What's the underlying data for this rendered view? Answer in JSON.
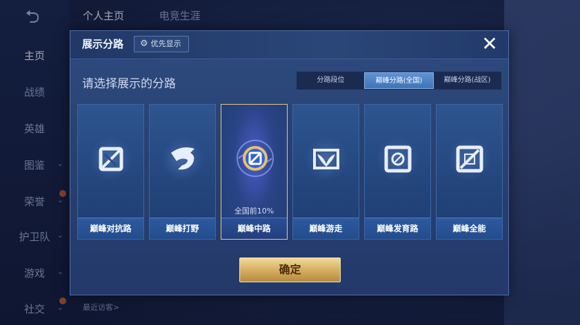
{
  "background": {
    "sidebar": [
      "主页",
      "战绩",
      "英雄",
      "图鉴",
      "荣誉",
      "护卫队",
      "游戏",
      "社交"
    ],
    "tabs": [
      "个人主页",
      "电竞生涯"
    ],
    "footer_text": "最近访客>"
  },
  "dialog": {
    "title": "展示分路",
    "priority_label": "优先显示",
    "prompt": "请选择展示的分路",
    "tabs": [
      {
        "label": "分路段位",
        "active": false
      },
      {
        "label": "巅峰分路(全国)",
        "active": true
      },
      {
        "label": "巅峰分路(战区)",
        "active": false
      }
    ],
    "cards": [
      {
        "label": "巅峰对抗路",
        "icon": "sword-cross-icon",
        "selected": false
      },
      {
        "label": "巅峰打野",
        "icon": "dragon-icon",
        "selected": false
      },
      {
        "label": "巅峰中路",
        "icon": "mage-emblem-icon",
        "selected": true,
        "rank": "全国前10%"
      },
      {
        "label": "巅峰游走",
        "icon": "wings-icon",
        "selected": false
      },
      {
        "label": "巅峰发育路",
        "icon": "target-icon",
        "selected": false
      },
      {
        "label": "巅峰全能",
        "icon": "all-round-icon",
        "selected": false
      }
    ],
    "confirm_label": "确定"
  },
  "colors": {
    "accent_gold": "#d9b466",
    "selected_border": "#e8c98a",
    "tab_active": "#4f86c8"
  }
}
